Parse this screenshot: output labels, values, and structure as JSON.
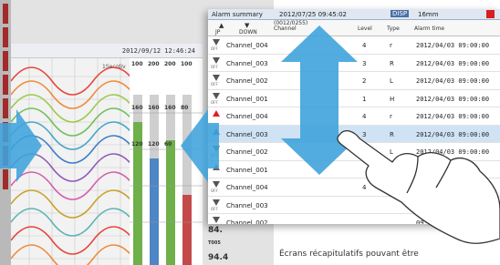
{
  "trend": {
    "header_datetime": "2012/09/12 12:46:24",
    "div_label": "1Sec/div",
    "bar_scale": [
      "100",
      "200",
      "200",
      "100"
    ],
    "bar_mid_values": [
      "160",
      "160",
      "160",
      "80",
      "120",
      "120",
      "60"
    ],
    "digital_value_1": "84.",
    "digital_value_2": "94.4",
    "digital_label": "T005"
  },
  "alarm": {
    "status": {
      "title": "Alarm summary",
      "datetime": "2012/07/25 09:45:02",
      "disp": "DISP",
      "mem": "16mm"
    },
    "header": {
      "up_label": "JP",
      "down_label": "DOWN",
      "channel_label": "(0012/0255)\nChannel",
      "level_label": "Level",
      "type_label": "Type",
      "time_label": "Alarm time"
    },
    "rows": [
      {
        "icon": "down",
        "sub": "OFF",
        "channel": "Channel_004",
        "level": "4",
        "type": "r",
        "time": "2012/04/03 09:00:00",
        "selected": false
      },
      {
        "icon": "down",
        "sub": "OFF",
        "channel": "Channel_003",
        "level": "3",
        "type": "R",
        "time": "2012/04/03 09:00:00",
        "selected": false
      },
      {
        "icon": "down",
        "sub": "OFF",
        "channel": "Channel_002",
        "level": "2",
        "type": "L",
        "time": "2012/04/03 09:00:00",
        "selected": false
      },
      {
        "icon": "down",
        "sub": "OFF",
        "channel": "Channel_001",
        "level": "1",
        "type": "H",
        "time": "2012/04/03 09:00:00",
        "selected": false
      },
      {
        "icon": "up-red",
        "sub": "",
        "channel": "Channel_004",
        "level": "4",
        "type": "r",
        "time": "2012/04/03 09:00:00",
        "selected": false
      },
      {
        "icon": "up-gray",
        "sub": "",
        "channel": "Channel_003",
        "level": "3",
        "type": "R",
        "time": "2012/04/03 09:00:00",
        "selected": true
      },
      {
        "icon": "down",
        "sub": "OFF",
        "channel": "Channel_002",
        "level": "",
        "type": "L",
        "time": "2012/04/03 09:00:00",
        "selected": false
      },
      {
        "icon": "up-gray",
        "sub": "",
        "channel": "Channel_001",
        "level": "",
        "type": "",
        "time": "09:00:00",
        "selected": false
      },
      {
        "icon": "down",
        "sub": "OFF",
        "channel": "Channel_004",
        "level": "4",
        "type": "",
        "time": "09:00:00",
        "selected": false
      },
      {
        "icon": "down",
        "sub": "OFF",
        "channel": "Channel_003",
        "level": "",
        "type": "",
        "time": "09:00:00",
        "selected": false
      },
      {
        "icon": "down",
        "sub": "OFF",
        "channel": "Channel_002",
        "level": "",
        "type": "",
        "time": "09:00:00",
        "selected": false
      }
    ]
  },
  "caption": "Écrans récapitulatifs pouvant être",
  "colors": {
    "arrow": "#3fa3dc",
    "hand_fill": "#ffffff",
    "hand_stroke": "#333333",
    "selected_row": "#cfe3f4",
    "alarm_red": "#e02020"
  },
  "icons": [
    "down-arrow-icon",
    "up-arrow-icon",
    "vertical-double-arrow-icon",
    "horizontal-double-arrow-icon",
    "touch-hand-icon"
  ]
}
